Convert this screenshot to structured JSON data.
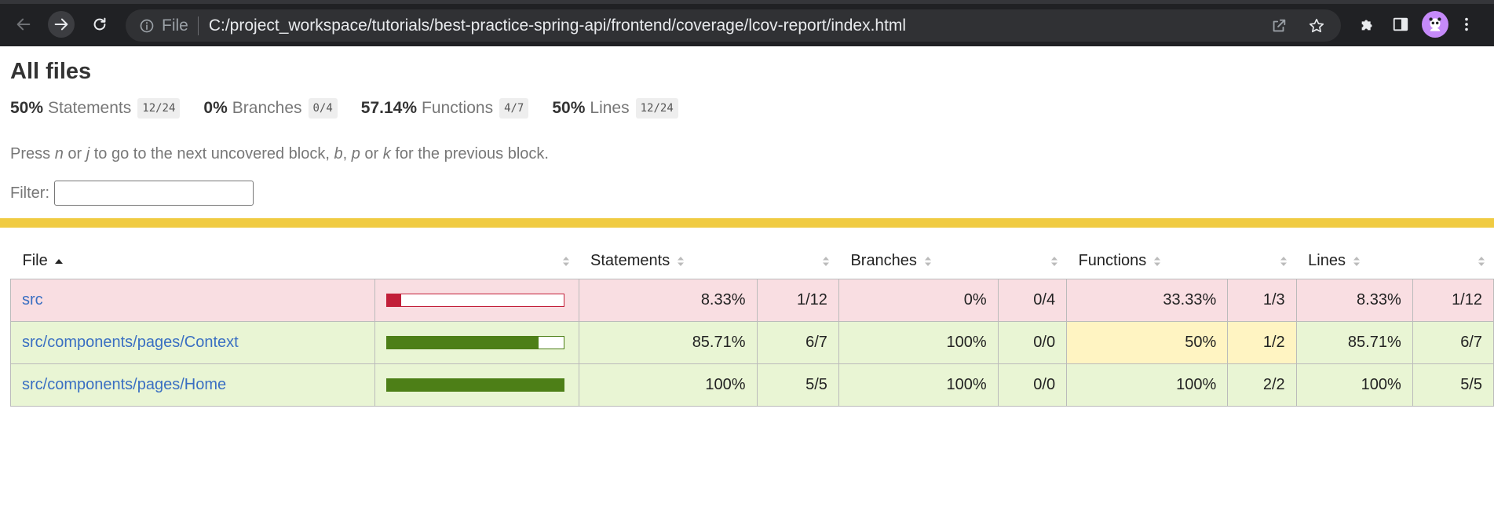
{
  "browser": {
    "omnibox_scheme": "File",
    "url": "C:/project_workspace/tutorials/best-practice-spring-api/frontend/coverage/lcov-report/index.html"
  },
  "page": {
    "title": "All files",
    "summary": [
      {
        "pct": "50%",
        "label": "Statements",
        "frac": "12/24"
      },
      {
        "pct": "0%",
        "label": "Branches",
        "frac": "0/4"
      },
      {
        "pct": "57.14%",
        "label": "Functions",
        "frac": "4/7"
      },
      {
        "pct": "50%",
        "label": "Lines",
        "frac": "12/24"
      }
    ],
    "hint": {
      "part1": "Press ",
      "key1": "n",
      "part2": " or ",
      "key2": "j",
      "part3": " to go to the next uncovered block, ",
      "key3": "b",
      "part4": ", ",
      "key4": "p",
      "part5": " or ",
      "key5": "k",
      "part6": " for the previous block."
    },
    "filter_label": "Filter:",
    "filter_value": ""
  },
  "table": {
    "headers": {
      "file": "File",
      "statements": "Statements",
      "branches": "Branches",
      "functions": "Functions",
      "lines": "Lines"
    },
    "rows": [
      {
        "file": "src",
        "coverage_pct": 8.33,
        "statements_pct": "8.33%",
        "statements_frac": "1/12",
        "branches_pct": "0%",
        "branches_frac": "0/4",
        "functions_pct": "33.33%",
        "functions_frac": "1/3",
        "lines_pct": "8.33%",
        "lines_frac": "1/12"
      },
      {
        "file": "src/components/pages/Context",
        "coverage_pct": 85.71,
        "statements_pct": "85.71%",
        "statements_frac": "6/7",
        "branches_pct": "100%",
        "branches_frac": "0/0",
        "functions_pct": "50%",
        "functions_frac": "1/2",
        "lines_pct": "85.71%",
        "lines_frac": "6/7"
      },
      {
        "file": "src/components/pages/Home",
        "coverage_pct": 100,
        "statements_pct": "100%",
        "statements_frac": "5/5",
        "branches_pct": "100%",
        "branches_frac": "0/0",
        "functions_pct": "100%",
        "functions_frac": "2/2",
        "lines_pct": "100%",
        "lines_frac": "5/5"
      }
    ]
  },
  "colors": {
    "yellow_bar": "#f0cb42",
    "low_row": "#f9dee2",
    "high_row": "#e9f5d4",
    "medium_cell": "#fff4c2",
    "bar_low": "#c21f39",
    "bar_high": "#4d7f17"
  },
  "icons": {
    "back": "arrow-left-icon",
    "forward": "arrow-right-icon",
    "reload": "reload-icon",
    "info": "info-icon",
    "share": "share-icon",
    "bookmark": "star-icon",
    "extensions": "puzzle-icon",
    "side_panel": "side-panel-icon",
    "profile": "avatar-icon",
    "menu": "kebab-menu-icon",
    "sort": "sort-icon",
    "sort_asc": "sort-ascending-icon"
  }
}
